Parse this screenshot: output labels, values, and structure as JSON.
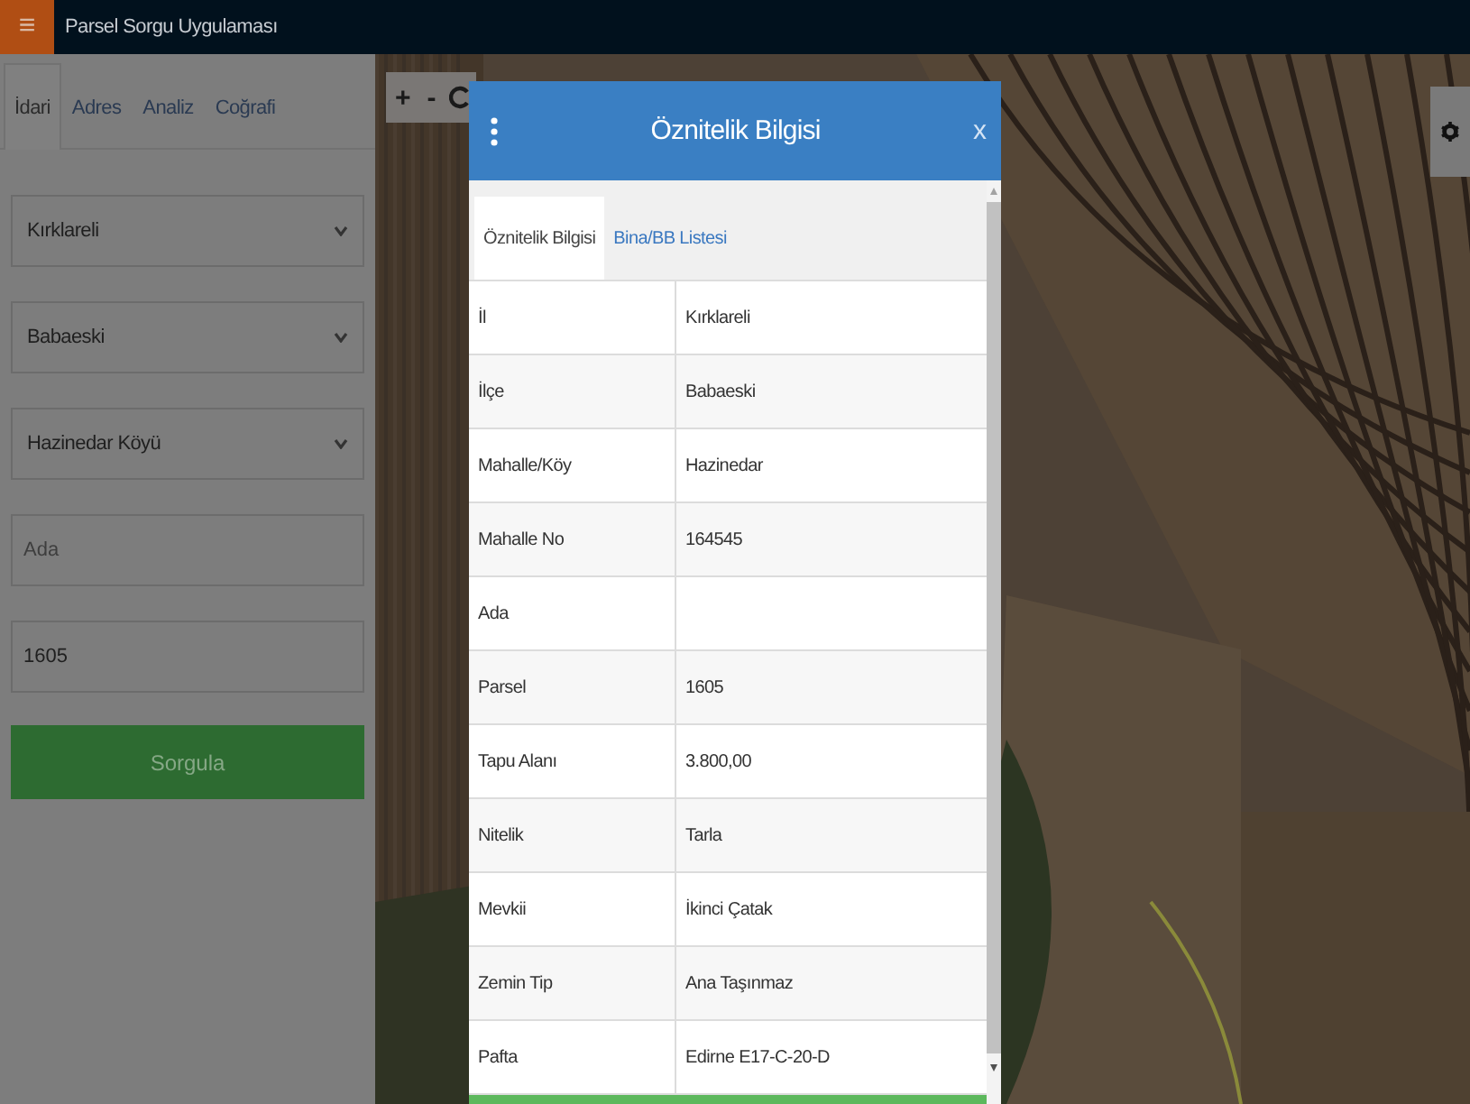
{
  "app": {
    "title": "Parsel Sorgu Uygulaması",
    "menu_icon": "≡"
  },
  "sidebar": {
    "tabs": [
      {
        "label": "İdari",
        "selected": true
      },
      {
        "label": "Adres",
        "selected": false
      },
      {
        "label": "Analiz",
        "selected": false
      },
      {
        "label": "Coğrafi",
        "selected": false
      }
    ],
    "fields": [
      {
        "kind": "select",
        "value": "Kırklareli"
      },
      {
        "kind": "select",
        "value": "Babaeski"
      },
      {
        "kind": "select",
        "value": "Hazinedar Köyü"
      },
      {
        "kind": "input",
        "placeholder": "Ada"
      },
      {
        "kind": "input",
        "value": "1605"
      }
    ],
    "submit": "Sorgula"
  },
  "map_tools": [
    "+",
    "-"
  ],
  "dialog": {
    "title": "Öznitelik Bilgisi",
    "close": "x",
    "tabs": [
      {
        "label": "Öznitelik Bilgisi",
        "selected": true
      },
      {
        "label": "Bina/BB Listesi",
        "selected": false
      }
    ],
    "rows": [
      {
        "key": "İl",
        "value": "Kırklareli"
      },
      {
        "key": "İlçe",
        "value": "Babaeski"
      },
      {
        "key": "Mahalle/Köy",
        "value": "Hazinedar"
      },
      {
        "key": "Mahalle No",
        "value": "164545"
      },
      {
        "key": "Ada"
      },
      {
        "key": "Parsel",
        "value": "1605"
      },
      {
        "key": "Tapu Alanı",
        "value": "3.800,00"
      },
      {
        "key": "Nitelik",
        "value": "Tarla"
      },
      {
        "key": "Mevkii",
        "value": "İkinci Çatak"
      },
      {
        "key": "Zemin Tip",
        "value": "Ana Taşınmaz"
      },
      {
        "key": "Pafta",
        "value": "Edirne E17-C-20-D"
      }
    ]
  }
}
